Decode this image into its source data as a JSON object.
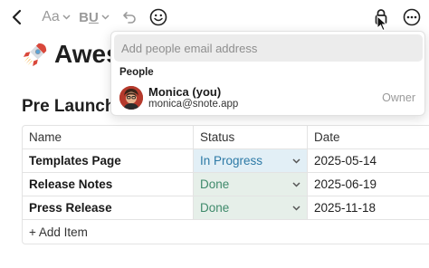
{
  "toolbar": {
    "back_icon": "chevron-left-icon",
    "font_label": "Aa",
    "style_bold": "B",
    "style_underline": "U",
    "undo_icon": "undo-icon",
    "emoji_icon": "smiley-icon",
    "share_icon": "lock-icon",
    "more_icon": "more-icon"
  },
  "document": {
    "title_visible": "Awes",
    "title_emoji": "rocket-icon",
    "section_heading_visible": "Pre Launch"
  },
  "table": {
    "columns": [
      "Name",
      "Status",
      "Date"
    ],
    "rows": [
      {
        "name": "Templates Page",
        "status": "In Progress",
        "date": "2025-05-14"
      },
      {
        "name": "Release Notes",
        "status": "Done",
        "date": "2025-06-19"
      },
      {
        "name": "Press Release",
        "status": "Done",
        "date": "2025-11-18"
      }
    ],
    "add_item_label": "+ Add Item"
  },
  "share_popup": {
    "email_placeholder": "Add people email address",
    "people_label": "People",
    "members": [
      {
        "name": "Monica (you)",
        "email": "monica@snote.app",
        "role": "Owner"
      }
    ]
  },
  "colors": {
    "in_progress_bg": "#e2eff6",
    "in_progress_text": "#2d7aa6",
    "done_bg": "#e6efe9",
    "done_text": "#3f8a6b",
    "avatar_bg": "#b53a2c"
  }
}
